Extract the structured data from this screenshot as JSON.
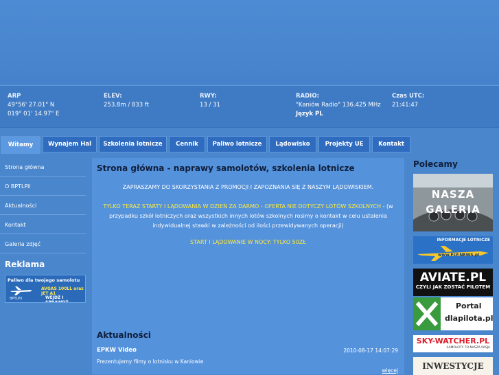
{
  "info": {
    "arp": {
      "label": "ARP",
      "line1": "49°56' 27.01\" N",
      "line2": "019° 01' 14.97\" E"
    },
    "elev": {
      "label": "ELEV:",
      "value": "253.8m / 833 ft"
    },
    "rwy": {
      "label": "RWY:",
      "value": "13 / 31"
    },
    "radio": {
      "label": "RADIO:",
      "value": "\"Kaniów Radio\" 136.425 MHz",
      "lang": "Język PL"
    },
    "utc": {
      "label": "Czas UTC:",
      "value": "21:41:47"
    }
  },
  "nav": {
    "tabs": [
      {
        "label": "Witamy",
        "active": true
      },
      {
        "label": "Wynajem Hal"
      },
      {
        "label": "Szkolenia lotnicze"
      },
      {
        "label": "Cennik"
      },
      {
        "label": "Paliwo lotnicze"
      },
      {
        "label": "Lądowisko"
      },
      {
        "label": "Projekty UE"
      },
      {
        "label": "Kontakt"
      }
    ]
  },
  "sidebar": {
    "items": [
      {
        "label": "Strona główna"
      },
      {
        "label": "O BPTLPil"
      },
      {
        "label": "Aktualności"
      },
      {
        "label": "Kontakt"
      },
      {
        "label": "Galeria zdjęć"
      }
    ],
    "reklama_title": "Reklama",
    "ad": {
      "line1": "Paliwo dla twojego samolotu",
      "line2": "AVGAS 100LL oraz JET A1",
      "line3": "WEJDŹ I SPRAWDŹ",
      "logo": "BPTLPil"
    }
  },
  "main": {
    "title": "Strona główna - naprawy samolotów, szkolenia lotnicze",
    "p1": "ZAPRASZAMY DO SKORZYSTANIA Z PROMOCJI I ZAPOZNANIA SIĘ Z NASZYM LĄDOWISKIEM.",
    "p2_highlight": "TYLKO TERAZ STARTY I LĄDOWANIA W DZIEŃ ZA DARMO - OFERTA NIE DOTYCZY LOTÓW SZKOLNYCH",
    "p2_rest": " - (w przypadku szkół lotniczych oraz wszystkich innych lotów szkolnych rosimy o kontakt w celu ustalenia indywidualnej stawki w zależności od ilości przewidywanych operacji)",
    "p3": "START I LĄDOWANIE W NOCY: TYLKO 50ZŁ",
    "news_title": "Aktualności",
    "news_item": {
      "title": "EPKW Video",
      "date": "2010-08-17 14:07:29",
      "text": "Prezentujemy filmy o lotnisku w Kaniowie",
      "more": "więcej"
    }
  },
  "right": {
    "title": "Polecamy",
    "gallery": {
      "line1": "NASZA",
      "line2": "GALERIA"
    },
    "info_banner": {
      "line1": "INFORMACJE LOTNICZE",
      "line2": "www.FLY-NEWS.pl"
    },
    "aviate": {
      "line1": "AVIATE.PL",
      "line2": "CZYLI JAK ZOSTAĆ PILOTEM"
    },
    "dlapilota": {
      "line1": "Portal",
      "line2": "dlapilota.pl"
    },
    "sky": {
      "line1": "SKY-WATCHER.PL",
      "line2": "SAMOLOTY TO NASZA PASJA"
    },
    "inwest": {
      "line1": "INWESTYCJE"
    }
  },
  "colors": {
    "background": "#4a86cc",
    "title": "#101f3c",
    "highlight": "#ffeb3b"
  }
}
